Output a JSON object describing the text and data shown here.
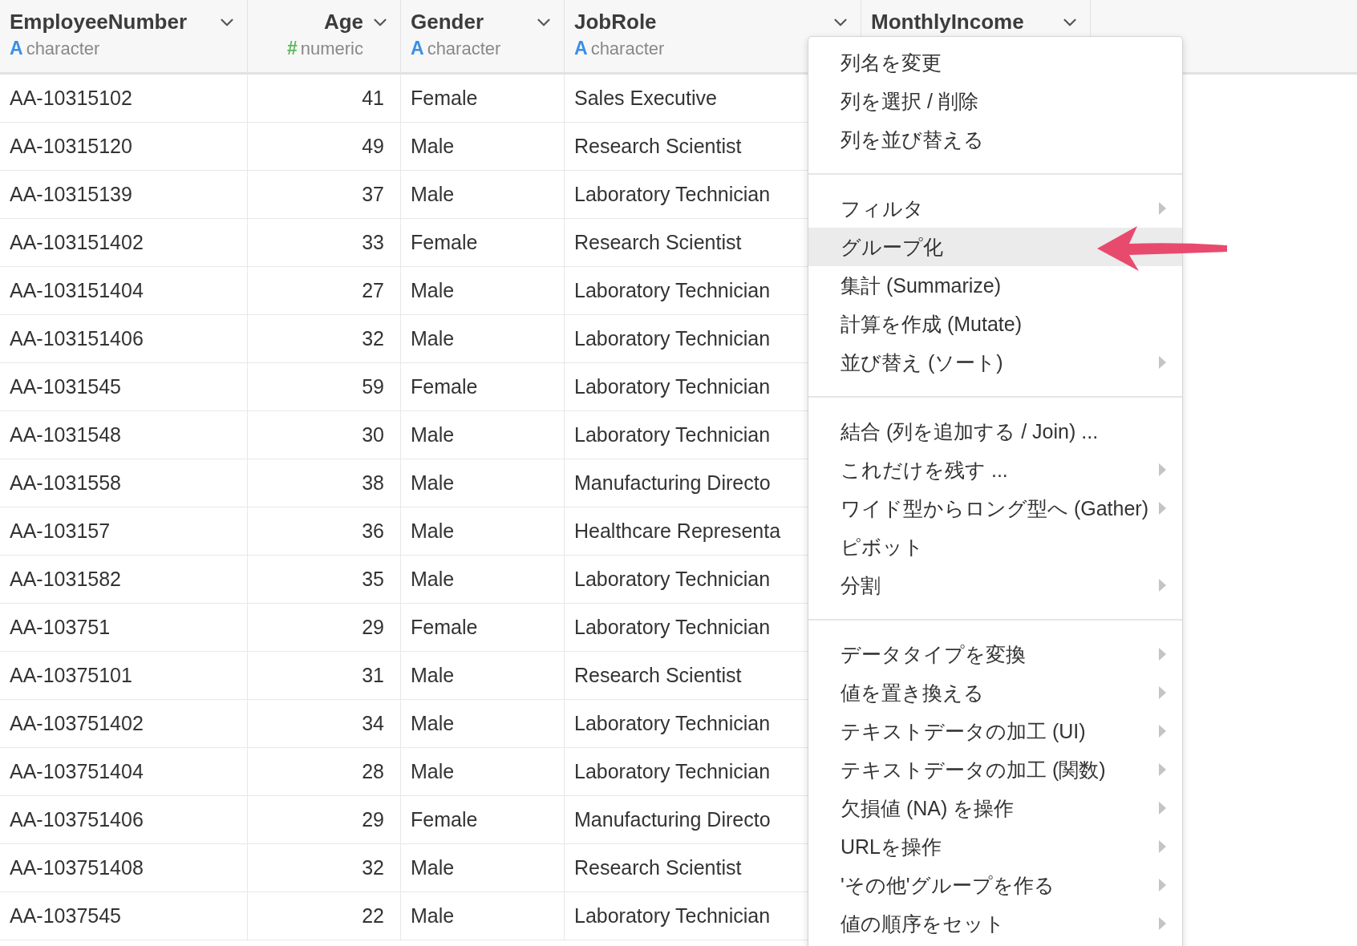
{
  "table": {
    "columns": [
      {
        "name": "EmployeeNumber",
        "kind": "character",
        "type_glyph": "A",
        "type_label": "character"
      },
      {
        "name": "Age",
        "kind": "numeric",
        "type_glyph": "#",
        "type_label": "numeric"
      },
      {
        "name": "Gender",
        "kind": "character",
        "type_glyph": "A",
        "type_label": "character"
      },
      {
        "name": "JobRole",
        "kind": "character",
        "type_glyph": "A",
        "type_label": "character"
      },
      {
        "name": "MonthlyIncome"
      }
    ],
    "rows": [
      [
        "AA-10315102",
        "41",
        "Female",
        "Sales Executive"
      ],
      [
        "AA-10315120",
        "49",
        "Male",
        "Research Scientist"
      ],
      [
        "AA-10315139",
        "37",
        "Male",
        "Laboratory Technician"
      ],
      [
        "AA-103151402",
        "33",
        "Female",
        "Research Scientist"
      ],
      [
        "AA-103151404",
        "27",
        "Male",
        "Laboratory Technician"
      ],
      [
        "AA-103151406",
        "32",
        "Male",
        "Laboratory Technician"
      ],
      [
        "AA-1031545",
        "59",
        "Female",
        "Laboratory Technician"
      ],
      [
        "AA-1031548",
        "30",
        "Male",
        "Laboratory Technician"
      ],
      [
        "AA-1031558",
        "38",
        "Male",
        "Manufacturing Directo"
      ],
      [
        "AA-103157",
        "36",
        "Male",
        "Healthcare Representa"
      ],
      [
        "AA-1031582",
        "35",
        "Male",
        "Laboratory Technician"
      ],
      [
        "AA-103751",
        "29",
        "Female",
        "Laboratory Technician"
      ],
      [
        "AA-10375101",
        "31",
        "Male",
        "Research Scientist"
      ],
      [
        "AA-103751402",
        "34",
        "Male",
        "Laboratory Technician"
      ],
      [
        "AA-103751404",
        "28",
        "Male",
        "Laboratory Technician"
      ],
      [
        "AA-103751406",
        "29",
        "Female",
        "Manufacturing Directo"
      ],
      [
        "AA-103751408",
        "32",
        "Male",
        "Research Scientist"
      ],
      [
        "AA-1037545",
        "22",
        "Male",
        "Laboratory Technician"
      ]
    ]
  },
  "context_menu": {
    "sections": [
      {
        "items": [
          {
            "label": "列名を変更",
            "submenu": false,
            "highlighted": false
          },
          {
            "label": "列を選択 / 削除",
            "submenu": false,
            "highlighted": false
          },
          {
            "label": "列を並び替える",
            "submenu": false,
            "highlighted": false
          }
        ]
      },
      {
        "items": [
          {
            "label": "フィルタ",
            "submenu": true,
            "highlighted": false
          },
          {
            "label": "グループ化",
            "submenu": false,
            "highlighted": true
          },
          {
            "label": "集計 (Summarize)",
            "submenu": false,
            "highlighted": false
          },
          {
            "label": "計算を作成 (Mutate)",
            "submenu": false,
            "highlighted": false
          },
          {
            "label": "並び替え (ソート)",
            "submenu": true,
            "highlighted": false
          }
        ]
      },
      {
        "items": [
          {
            "label": "結合 (列を追加する / Join) ...",
            "submenu": false,
            "highlighted": false
          },
          {
            "label": "これだけを残す ...",
            "submenu": true,
            "highlighted": false
          },
          {
            "label": "ワイド型からロング型へ (Gather)",
            "submenu": true,
            "highlighted": false
          },
          {
            "label": "ピボット",
            "submenu": false,
            "highlighted": false
          },
          {
            "label": "分割",
            "submenu": true,
            "highlighted": false
          }
        ]
      },
      {
        "items": [
          {
            "label": "データタイプを変換",
            "submenu": true,
            "highlighted": false
          },
          {
            "label": "値を置き換える",
            "submenu": true,
            "highlighted": false
          },
          {
            "label": "テキストデータの加工 (UI)",
            "submenu": true,
            "highlighted": false
          },
          {
            "label": "テキストデータの加工 (関数)",
            "submenu": true,
            "highlighted": false
          },
          {
            "label": "欠損値 (NA) を操作",
            "submenu": true,
            "highlighted": false
          },
          {
            "label": "URLを操作",
            "submenu": true,
            "highlighted": false
          },
          {
            "label": "'その他'グループを作る",
            "submenu": true,
            "highlighted": false
          },
          {
            "label": "値の順序をセット",
            "submenu": true,
            "highlighted": false
          }
        ]
      }
    ]
  }
}
